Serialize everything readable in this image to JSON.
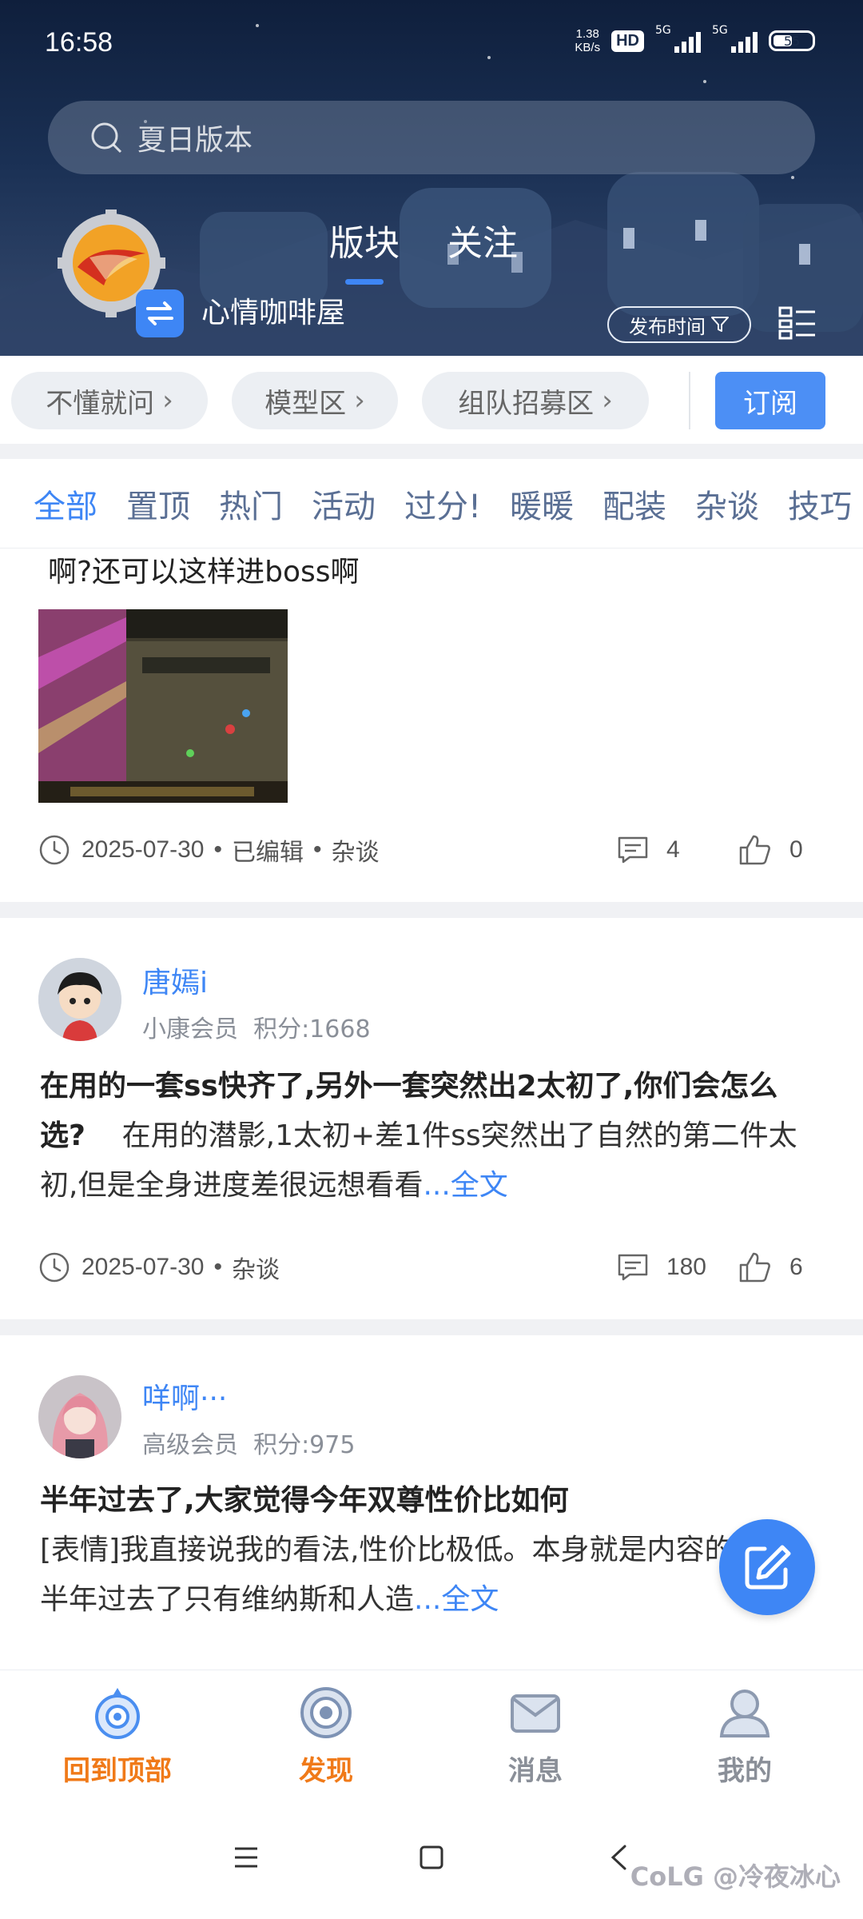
{
  "status_bar": {
    "time": "16:58",
    "net_speed_value": "1.38",
    "net_speed_unit": "KB/s",
    "hd_badge": "HD",
    "signal_1": "5G",
    "signal_2": "5G",
    "battery": "55"
  },
  "search": {
    "placeholder": "夏日版本"
  },
  "header": {
    "forum_name": "心情咖啡屋",
    "tabs": [
      {
        "label": "版块",
        "active": true
      },
      {
        "label": "关注",
        "active": false
      }
    ],
    "sort_label": "发布时间"
  },
  "subforums": {
    "chips": [
      "不懂就问",
      "模型区",
      "组队招募区"
    ],
    "subscribe_label": "订阅"
  },
  "categories": [
    "全部",
    "置顶",
    "热门",
    "活动",
    "过分!",
    "暖暖",
    "配装",
    "杂谈",
    "技巧"
  ],
  "posts": [
    {
      "title_fragment": "啊?还可以这样进boss啊",
      "date": "2025-07-30",
      "edited": "已编辑",
      "tag": "杂谈",
      "comments": "4",
      "likes": "0"
    },
    {
      "author": "唐嫣i",
      "level": "小康会员",
      "points": "积分:1668",
      "title": "在用的一套ss快齐了,另外一套突然出2太初了,你们会怎么选?",
      "body": "在用的潜影,1太初+差1件ss突然出了自然的第二件太初,但是全身进度差很远想看看",
      "more": "...全文",
      "date": "2025-07-30",
      "tag": "杂谈",
      "comments": "180",
      "likes": "6"
    },
    {
      "author": "咩啊···",
      "level": "高级会员",
      "points": "积分:975",
      "title": "半年过去了,大家觉得今年双尊性价比如何",
      "body": "[表情]我直接说我的看法,性价比极低。本身就是内容的版本,半年过去了只有维纳斯和人造",
      "more": "...全文"
    }
  ],
  "bottom_nav": [
    {
      "label": "回到顶部",
      "color": "#f07a19"
    },
    {
      "label": "发现",
      "color": "#f07a19"
    },
    {
      "label": "消息",
      "color": "#8a8f98"
    },
    {
      "label": "我的",
      "color": "#8a8f98"
    }
  ],
  "watermark": "CoLG @冷夜冰心",
  "colors": {
    "accent": "#3e86f5",
    "active_nav": "#f07a19"
  }
}
